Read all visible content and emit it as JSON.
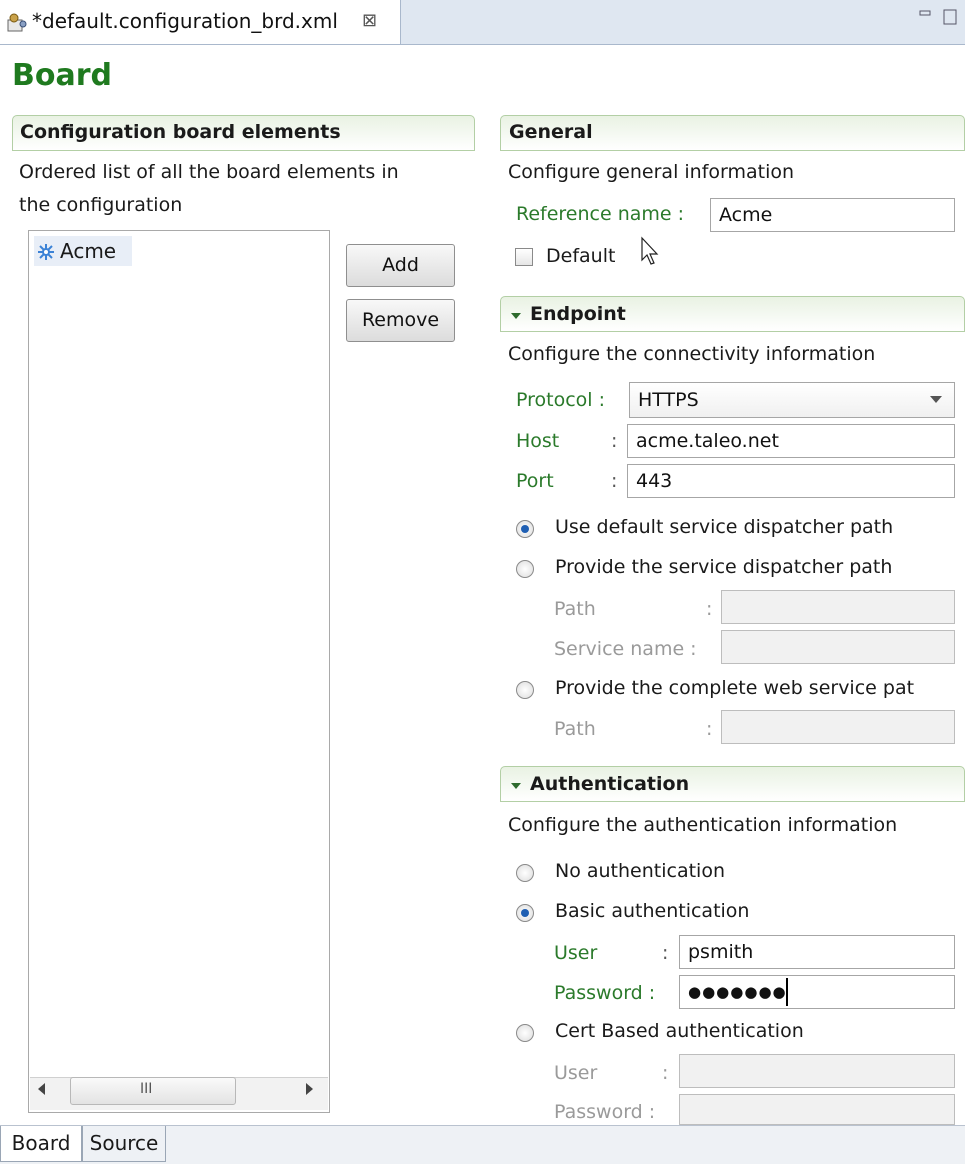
{
  "editor_tab": {
    "title": "*default.configuration_brd.xml",
    "close_glyph": "⊠",
    "icon": "config-file-icon"
  },
  "page": {
    "title": "Board"
  },
  "board_elements": {
    "title": "Configuration board elements",
    "description_line1": "Ordered list of all the board elements in",
    "description_line2": "the configuration",
    "items": [
      {
        "label": "Acme",
        "icon": "board-element-icon"
      }
    ],
    "add_label": "Add",
    "remove_label": "Remove",
    "scroll_thumb_glyph": "III"
  },
  "general": {
    "title": "General",
    "description": "Configure general information",
    "reference_name_label": "Reference name :",
    "reference_name_value": "Acme",
    "default_label": "Default"
  },
  "endpoint": {
    "title": "Endpoint",
    "description": "Configure the connectivity information",
    "protocol_label": "Protocol :",
    "protocol_value": "HTTPS",
    "host_label": "Host",
    "host_value": "acme.taleo.net",
    "port_label": "Port",
    "port_value": "443",
    "colon": ":",
    "opt_default_path": "Use default service dispatcher path",
    "opt_provide_path": "Provide the service dispatcher path",
    "path_label": "Path",
    "service_name_label": "Service name :",
    "opt_complete_path": "Provide the complete web service pat",
    "path2_label": "Path"
  },
  "authentication": {
    "title": "Authentication",
    "description": "Configure the authentication information",
    "opt_none": "No authentication",
    "opt_basic": "Basic authentication",
    "user_label": "User",
    "user_value": "psmith",
    "password_label": "Password :",
    "password_value": "●●●●●●●",
    "opt_cert": "Cert Based authentication",
    "cert_user_label": "User",
    "cert_password_label": "Password :"
  },
  "bottom_tabs": [
    {
      "label": "Board"
    },
    {
      "label": "Source"
    }
  ]
}
